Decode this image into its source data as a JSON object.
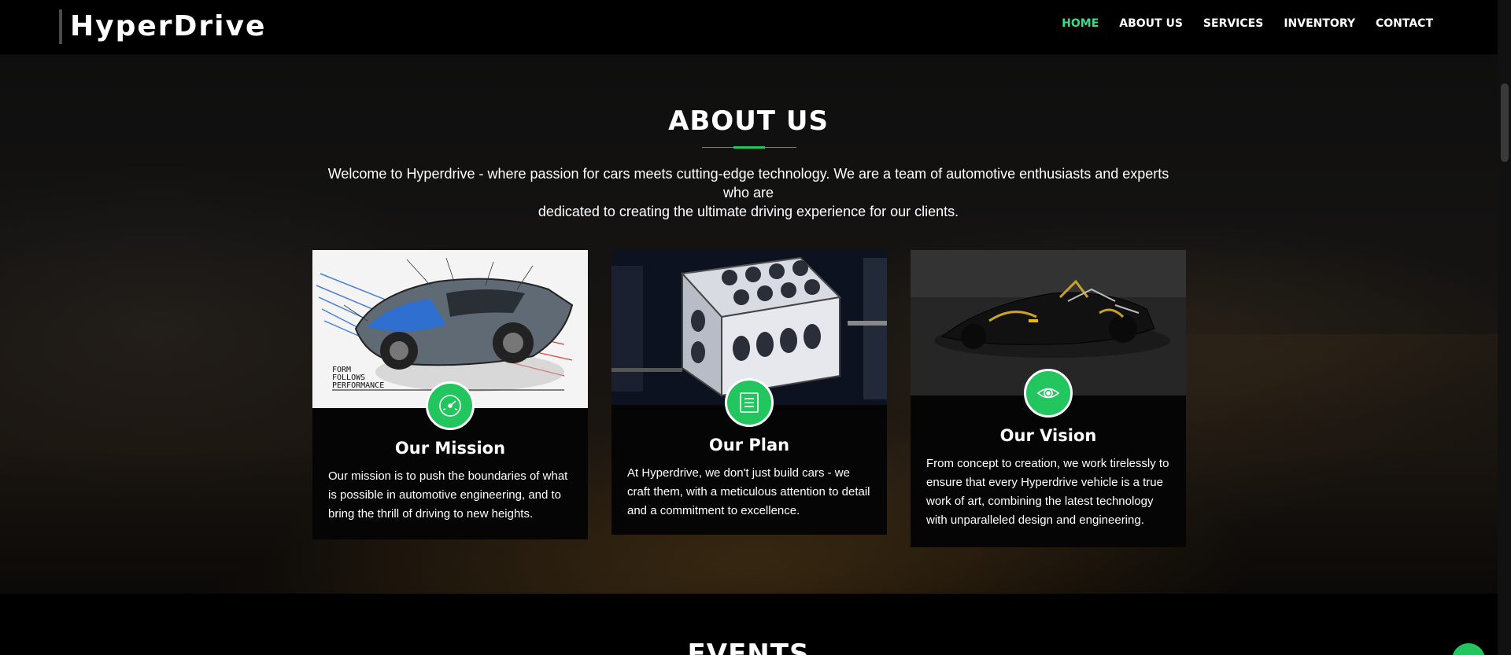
{
  "brand": {
    "name": "HyperDrive"
  },
  "nav": {
    "items": [
      {
        "label": "HOME",
        "active": true
      },
      {
        "label": "ABOUT US",
        "active": false
      },
      {
        "label": "SERVICES",
        "active": false
      },
      {
        "label": "INVENTORY",
        "active": false
      },
      {
        "label": "CONTACT",
        "active": false
      }
    ]
  },
  "about": {
    "title": "ABOUT US",
    "intro_line1": "Welcome to Hyperdrive - where passion for cars meets cutting-edge technology. We are a team of automotive enthusiasts and experts who are",
    "intro_line2": "dedicated to creating the ultimate driving experience for our clients.",
    "cards": [
      {
        "title": "Our Mission",
        "text": "Our mission is to push the boundaries of what is possible in automotive engineering, and to bring the thrill of driving to new heights.",
        "icon": "speedometer-icon",
        "image": "car-sketch-image",
        "sketch_text_1": "FORM",
        "sketch_text_2": "FOLLOWS",
        "sketch_text_3": "PERFORMANCE"
      },
      {
        "title": "Our Plan",
        "text": "At Hyperdrive, we don't just build cars - we craft them, with a meticulous attention to detail and a commitment to excellence.",
        "icon": "list-icon",
        "image": "engine-block-image"
      },
      {
        "title": "Our Vision",
        "text": "From concept to creation, we work tirelessly to ensure that every Hyperdrive vehicle is a true work of art, combining the latest technology with unparalleled design and engineering.",
        "icon": "eye-icon",
        "image": "car-chassis-image"
      }
    ]
  },
  "events": {
    "title": "EVENTS"
  },
  "colors": {
    "accent": "#22c55e",
    "nav_active": "#3ddc84",
    "background": "#050505"
  }
}
